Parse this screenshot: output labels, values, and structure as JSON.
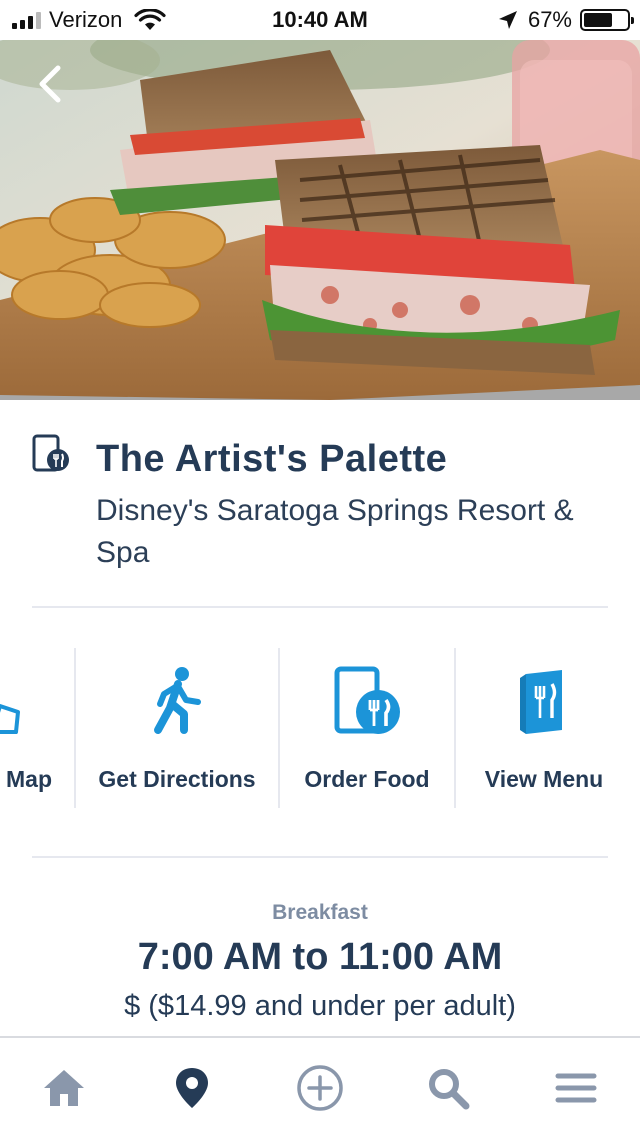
{
  "status_bar": {
    "carrier": "Verizon",
    "time": "10:40 AM",
    "battery": "67%",
    "battery_level": 0.67
  },
  "restaurant": {
    "name": "The Artist's Palette",
    "location": "Disney's Saratoga Springs Resort & Spa"
  },
  "actions": [
    {
      "label": "Map",
      "icon": "map-icon"
    },
    {
      "label": "Get Directions",
      "icon": "walking-person-icon"
    },
    {
      "label": "Order Food",
      "icon": "mobile-order-icon"
    },
    {
      "label": "View Menu",
      "icon": "menu-icon"
    }
  ],
  "hours": {
    "meal_period": "Breakfast",
    "time_range": "7:00 AM to 11:00 AM",
    "price": "$ ($14.99 and under per adult)"
  },
  "tab_bar": [
    {
      "icon": "home-icon"
    },
    {
      "icon": "location-pin-icon",
      "selected": true
    },
    {
      "icon": "plus-circle-icon"
    },
    {
      "icon": "search-icon"
    },
    {
      "icon": "hamburger-menu-icon"
    }
  ],
  "colors": {
    "primary_text": "#253b56",
    "secondary_text": "#7d8ca2",
    "accent_blue": "#1c94d8",
    "divider": "#e6e8ef",
    "tab_icon_inactive": "#8a97ab"
  }
}
